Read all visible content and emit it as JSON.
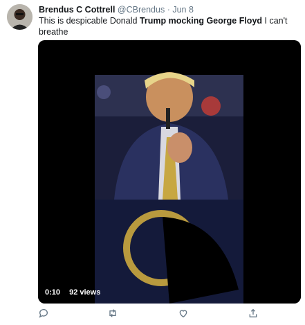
{
  "tweet": {
    "author_name": "Brendus C Cottrell",
    "handle": "@CBrendus",
    "separator": "·",
    "date": "Jun 8",
    "text_parts": [
      {
        "text": "This is despicable Donald ",
        "bold": false
      },
      {
        "text": "Trump mocking George Floyd",
        "bold": true
      },
      {
        "text": " I can't breathe",
        "bold": false
      }
    ]
  },
  "video": {
    "duration": "0:10",
    "views": "92 views"
  },
  "actions": [
    {
      "name": "reply-icon"
    },
    {
      "name": "retweet-icon"
    },
    {
      "name": "like-icon"
    },
    {
      "name": "share-icon"
    }
  ],
  "colors": {
    "text": "#14171a",
    "muted": "#657786",
    "icon": "#657786",
    "media_bg": "#000000"
  }
}
